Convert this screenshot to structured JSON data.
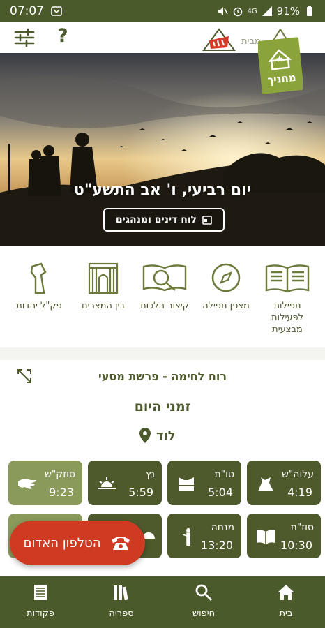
{
  "status_bar": {
    "time": "07:07",
    "network": "4G",
    "battery": "91%"
  },
  "header": {
    "home_crumb": "מבית",
    "app_logo_text": "מחניך"
  },
  "hero": {
    "date": "יום רביעי, ו' אב התשע\"ט",
    "laws_button": "לוח דינים ומנהגים"
  },
  "categories": [
    {
      "label": "תפילות לפעילות מבצעית",
      "icon": "open-book-icon"
    },
    {
      "label": "מצפן תפילה",
      "icon": "compass-icon"
    },
    {
      "label": "קיצור הלכות",
      "icon": "book-search-icon"
    },
    {
      "label": "בין המצרים",
      "icon": "temple-gate-icon"
    },
    {
      "label": "פק\"ל יהדות",
      "icon": "torch-icon"
    }
  ],
  "card": {
    "torah": "רוח לחימה - פרשת מסעי",
    "zmanim_title": "זמני היום",
    "location": "לוד"
  },
  "zmanim": [
    {
      "name": "עלוה\"ש",
      "time": "4:19",
      "icon": "sunrise-bird-icon"
    },
    {
      "name": "טו\"ת",
      "time": "5:04",
      "icon": "tallit-icon"
    },
    {
      "name": "נץ",
      "time": "5:59",
      "icon": "sunrise-icon"
    },
    {
      "name": "סוזק\"ש",
      "time": "9:23",
      "icon": "hands-icon"
    },
    {
      "name": "סוז\"ת",
      "time": "10:30",
      "icon": "book-icon"
    },
    {
      "name": "מנחה",
      "time": "13:20",
      "icon": "person-pray-icon"
    }
  ],
  "red_phone": {
    "label": "הטלפון האדום"
  },
  "bottom_nav": [
    {
      "label": "בית",
      "icon": "home-icon"
    },
    {
      "label": "חיפוש",
      "icon": "search-icon"
    },
    {
      "label": "ספריה",
      "icon": "library-icon"
    },
    {
      "label": "פקודות",
      "icon": "document-icon"
    }
  ],
  "colors": {
    "primary": "#4a5a2a",
    "tile": "#4e5a2c",
    "tile_light": "#8a9a5b",
    "accent": "#cf3a22",
    "logo": "#8aa33a"
  }
}
